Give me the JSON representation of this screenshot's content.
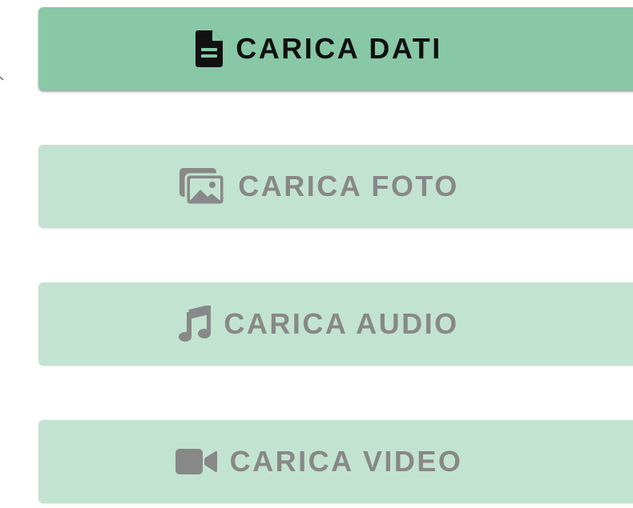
{
  "buttons": [
    {
      "label": "CARICA DATI",
      "icon": "file-document-icon",
      "state": "enabled"
    },
    {
      "label": "CARICA FOTO",
      "icon": "photo-gallery-icon",
      "state": "disabled"
    },
    {
      "label": "CARICA AUDIO",
      "icon": "music-note-icon",
      "state": "disabled"
    },
    {
      "label": "CARICA VIDEO",
      "icon": "video-camera-icon",
      "state": "disabled"
    }
  ],
  "colors": {
    "active_background": "#88c8a6",
    "disabled_background": "#c3e3d2",
    "active_text": "#111111",
    "disabled_text": "#888888"
  }
}
